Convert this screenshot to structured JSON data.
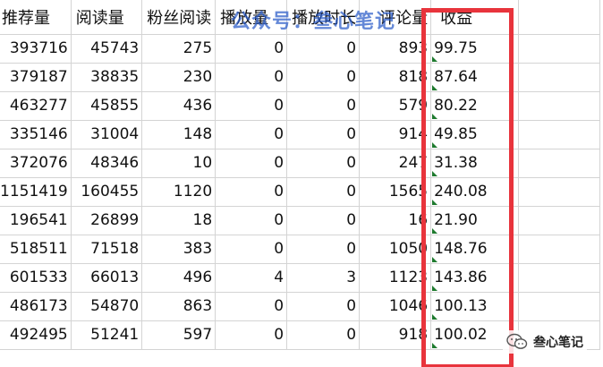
{
  "columns": [
    "推荐量",
    "阅读量",
    "粉丝阅读",
    "播放量",
    "播放时长",
    "评论量",
    "收益",
    ""
  ],
  "rows": [
    {
      "rec": "393716",
      "read": "45743",
      "fan": "275",
      "play": "0",
      "dur": "0",
      "cmt": "893",
      "income": "99.75"
    },
    {
      "rec": "379187",
      "read": "38835",
      "fan": "230",
      "play": "0",
      "dur": "0",
      "cmt": "818",
      "income": "87.64"
    },
    {
      "rec": "463277",
      "read": "45855",
      "fan": "436",
      "play": "0",
      "dur": "0",
      "cmt": "579",
      "income": "80.22"
    },
    {
      "rec": "335146",
      "read": "31004",
      "fan": "148",
      "play": "0",
      "dur": "0",
      "cmt": "914",
      "income": "49.85"
    },
    {
      "rec": "372076",
      "read": "48346",
      "fan": "10",
      "play": "0",
      "dur": "0",
      "cmt": "247",
      "income": "31.38"
    },
    {
      "rec": "1151419",
      "read": "160455",
      "fan": "1120",
      "play": "0",
      "dur": "0",
      "cmt": "1565",
      "income": "240.08"
    },
    {
      "rec": "196541",
      "read": "26899",
      "fan": "18",
      "play": "0",
      "dur": "0",
      "cmt": "16",
      "income": "21.90"
    },
    {
      "rec": "518511",
      "read": "71518",
      "fan": "383",
      "play": "0",
      "dur": "0",
      "cmt": "1050",
      "income": "148.76"
    },
    {
      "rec": "601533",
      "read": "66013",
      "fan": "496",
      "play": "4",
      "dur": "3",
      "cmt": "1123",
      "income": "143.86"
    },
    {
      "rec": "486173",
      "read": "54870",
      "fan": "863",
      "play": "0",
      "dur": "0",
      "cmt": "1046",
      "income": "100.13"
    },
    {
      "rec": "492495",
      "read": "51241",
      "fan": "597",
      "play": "0",
      "dur": "0",
      "cmt": "918",
      "income": "100.02"
    }
  ],
  "watermark": "公众号：叁心笔记",
  "brand": "叁心笔记",
  "colors": {
    "highlight": "#e8343c",
    "watermark": "#285ac8",
    "grid": "#d4d4d4",
    "cell_marker": "#1e7a2e"
  },
  "icons": {
    "brand": "wechat-bubble-icon",
    "cell_marker": "green-triangle-icon"
  }
}
